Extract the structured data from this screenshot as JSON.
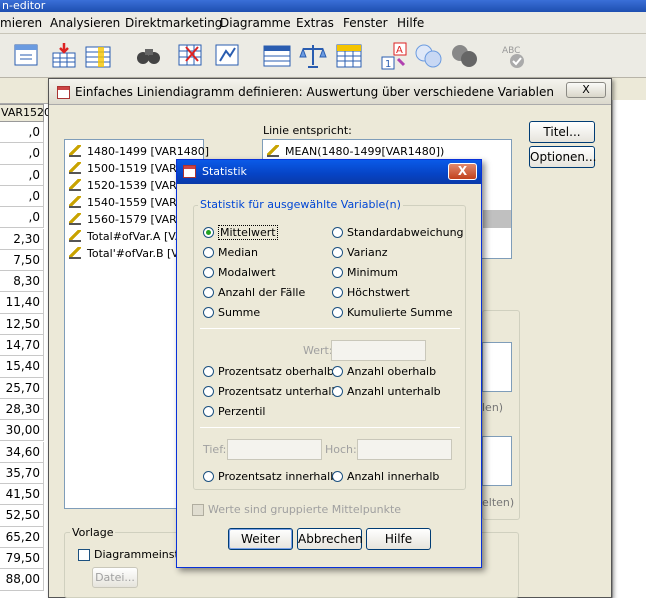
{
  "app": {
    "window_title": "n-editor"
  },
  "menu": [
    "mieren",
    "Analysieren",
    "Direktmarketing",
    "Diagramme",
    "Extras",
    "Fenster",
    "Hilfe"
  ],
  "toolbar_icons": [
    "variable-view-icon",
    "insert-cases-icon",
    "insert-variable-icon",
    "find-icon",
    "split-file-icon",
    "weight-cases-icon",
    "value-labels-icon",
    "scale-icon",
    "grid-icon",
    "insert-icon",
    "circles-icon",
    "circles-gray-icon",
    "spellcheck-icon"
  ],
  "grid": {
    "col_header": "VAR1520",
    "cells": [
      ",0",
      ",0",
      ",0",
      ",0",
      ",0",
      "2,30",
      "7,50",
      "8,30",
      "11,40",
      "12,50",
      "14,70",
      "15,40",
      "25,70",
      "28,30",
      "30,00",
      "34,60",
      "35,70",
      "41,50",
      "52,50",
      "65,20",
      "79,50",
      "88,00"
    ]
  },
  "chart_dialog": {
    "title": "Einfaches Liniendiagramm definieren: Auswertung über verschiedene Variablen",
    "close_label": "X",
    "titles_button": "Titel...",
    "options_button": "Optionen...",
    "source_variables": [
      "1480-1499 [VAR1480]",
      "1500-1519 [VAR1",
      "1520-1539 [VAR1",
      "1540-1559 [VAR1",
      "1560-1579 [VAR1",
      "Total#ofVar.A [VA",
      "Total'#ofVar.B [VA"
    ],
    "line_represents_label": "Linie entspricht:",
    "line_represents_items": [
      "MEAN(1480-1499[VAR1480])"
    ],
    "hidden_label_1": "len)",
    "hidden_label_2": "elten)",
    "template_group": "Vorlage",
    "template_checkbox": "Diagrammeinst",
    "file_button": "Datei..."
  },
  "stat_dialog": {
    "title": "Statistik",
    "close_label": "X",
    "group_label": "Statistik für ausgewählte Variable(n)",
    "radios_left": [
      "Mittelwert",
      "Median",
      "Modalwert",
      "Anzahl der Fälle",
      "Summe"
    ],
    "radios_right": [
      "Standardabweichung",
      "Varianz",
      "Minimum",
      "Höchstwert",
      "Kumulierte Summe"
    ],
    "value_label": "Wert:",
    "radios_value": [
      "Prozentsatz oberhalb",
      "Anzahl oberhalb",
      "Prozentsatz unterhalb",
      "Anzahl unterhalb",
      "Perzentil"
    ],
    "low_label": "Tief:",
    "high_label": "Hoch:",
    "radios_range": [
      "Prozentsatz innerhalb",
      "Anzahl innerhalb"
    ],
    "grouped_checkbox": "Werte sind gruppierte Mittelpunkte",
    "buttons": {
      "continue": "Weiter",
      "cancel": "Abbrechen",
      "help": "Hilfe"
    },
    "selected": "Mittelwert"
  }
}
